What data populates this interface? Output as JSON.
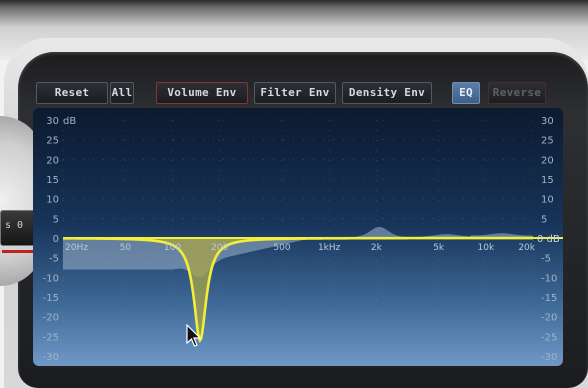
{
  "toolbar": {
    "reset_label": "Reset",
    "all_label": "All",
    "volume_env_label": "Volume Env",
    "filter_env_label": "Filter Env",
    "density_env_label": "Density Env",
    "eq_label": "EQ",
    "reverse_label": "Reverse"
  },
  "left_panel": {
    "display_text": "s 0"
  },
  "eq_graph": {
    "db_unit": "dB",
    "db_unit_right": "0 dB",
    "db_ticks_left": [
      "30",
      "25",
      "20",
      "15",
      "10",
      "5",
      "0",
      "-5",
      "-10",
      "-15",
      "-20",
      "-25",
      "-30"
    ],
    "db_ticks_right": [
      "30",
      "25",
      "20",
      "15",
      "10",
      "5",
      "",
      "-5",
      "-10",
      "-15",
      "-20",
      "-25",
      "-30"
    ],
    "freq_labels": [
      "20Hz",
      "50",
      "100",
      "200",
      "500",
      "1kHz",
      "2k",
      "5k",
      "10k",
      "20k"
    ],
    "band_dip": {
      "frequency_hz": 150,
      "gain_db": -26
    },
    "colors": {
      "curve": "#f2ee3a",
      "fill": "#a8a44a",
      "shadow": "#9fb4cc",
      "grid": "#6f8fb3"
    }
  },
  "cursor_icon": "arrow-cursor-icon"
}
